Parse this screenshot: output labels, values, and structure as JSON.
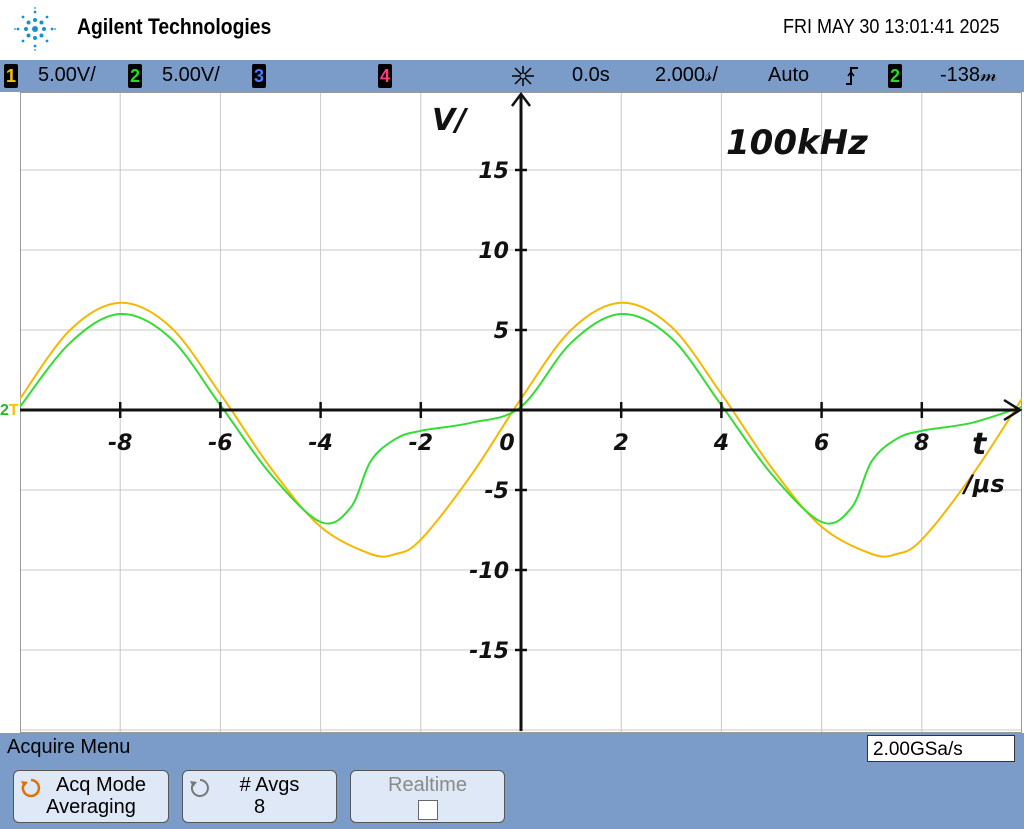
{
  "header": {
    "brand": "Agilent Technologies",
    "datetime": "FRI MAY 30 13:01:41 2025"
  },
  "status": {
    "ch1": {
      "num": "1",
      "scale": "5.00V/",
      "color": "#f5c400"
    },
    "ch2": {
      "num": "2",
      "scale": "5.00V/",
      "color": "#22dd22"
    },
    "ch3": {
      "num": "3",
      "color": "#4a7aff"
    },
    "ch4": {
      "num": "4",
      "color": "#ff3c7a"
    },
    "trigger_pos_icon": "trigger-position-icon",
    "delay": "0.0s",
    "timebase": "2.000𝓈/",
    "trigger_mode": "Auto",
    "trigger_slope_icon": "rising-edge-icon",
    "trigger_source": "2",
    "trigger_level": "-138𝓂"
  },
  "annotations": {
    "freq": "100kHz",
    "y_unit": "V/",
    "x_unit_t": "t",
    "x_unit_us": "/μs",
    "y_ticks": [
      "15",
      "10",
      "5",
      "-5",
      "-10",
      "-15"
    ],
    "x_ticks": [
      "-8",
      "-6",
      "-4",
      "-2",
      "0",
      "2",
      "4",
      "6",
      "8"
    ]
  },
  "markers": {
    "ground": "2"
  },
  "chart_data": {
    "type": "line",
    "xlabel": "t/μs",
    "ylabel": "V",
    "xlim": [
      -10,
      10
    ],
    "ylim": [
      -20,
      20
    ],
    "grid": true,
    "series": [
      {
        "color": "#f5b800",
        "x": [
          -10,
          -9,
          -8,
          -7,
          -6,
          -5,
          -4,
          -3,
          -2.5,
          -2,
          -1,
          0,
          1,
          2,
          3,
          4,
          5,
          6,
          7,
          7.5,
          8,
          9,
          10
        ],
        "y": [
          0.7,
          5.0,
          6.7,
          5.2,
          1.0,
          -3.6,
          -7.3,
          -9.0,
          -9.0,
          -8.1,
          -4.1,
          0.7,
          5.0,
          6.7,
          5.2,
          1.0,
          -3.6,
          -7.3,
          -9.0,
          -9.0,
          -8.1,
          -4.1,
          0.7
        ]
      },
      {
        "color": "#33dd33",
        "x": [
          -10,
          -9,
          -8,
          -7,
          -6,
          -5,
          -4,
          -3.4,
          -3.0,
          -2.5,
          -2,
          -1,
          0,
          1,
          2,
          3,
          4,
          5,
          6,
          6.6,
          7.0,
          7.5,
          8,
          9,
          10
        ],
        "y": [
          0.2,
          4.2,
          6.0,
          4.5,
          0.3,
          -4.0,
          -7.0,
          -6.1,
          -3.2,
          -1.8,
          -1.3,
          -0.8,
          0.2,
          4.2,
          6.0,
          4.5,
          0.3,
          -4.0,
          -7.0,
          -6.1,
          -3.2,
          -1.8,
          -1.3,
          -0.8,
          0.2
        ]
      }
    ]
  },
  "menu": {
    "title": "Acquire Menu",
    "sample_rate": "2.00GSa/s",
    "softkeys": [
      {
        "line1": "Acq Mode",
        "line2": "Averaging"
      },
      {
        "line1": "# Avgs",
        "line2": "8"
      },
      {
        "line1": "Realtime",
        "line2": ""
      }
    ]
  }
}
